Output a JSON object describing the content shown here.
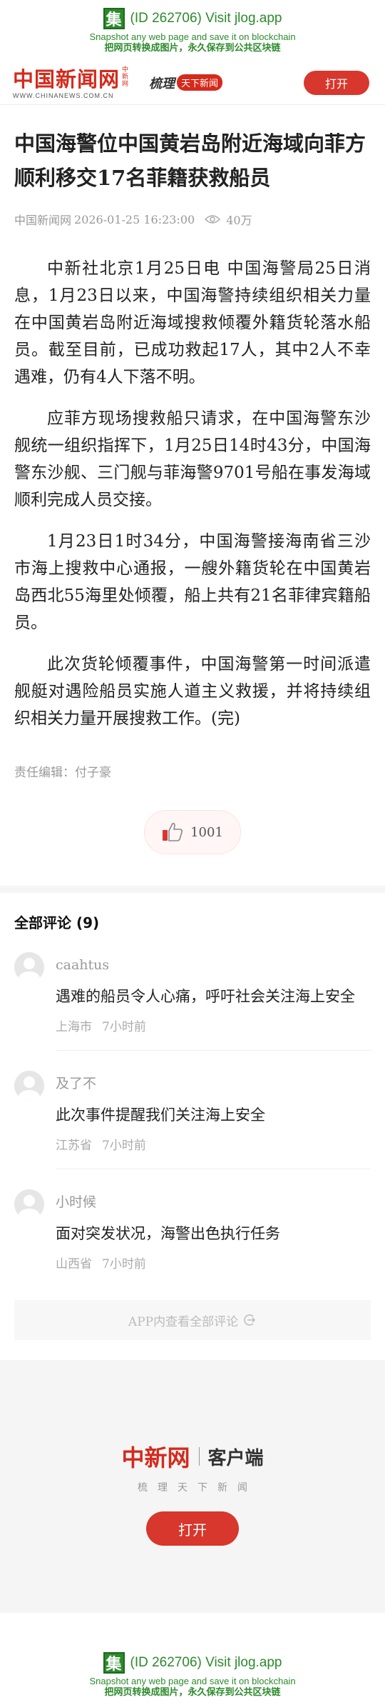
{
  "jlog": {
    "logo": "集",
    "title": "(ID 262706) Visit jlog.app",
    "line1": "Snapshot any web page and save it on blockchain",
    "line2": "把网页转换成图片，永久保存到公共区块链"
  },
  "header": {
    "brand": "中国新闻网",
    "brand_tag": "中新网",
    "url": "WWW.CHINANEWS.COM.CN",
    "slogan_a": "梳理",
    "slogan_b": "天下新闻",
    "open_label": "打开",
    "accent_color": "#d7372c"
  },
  "article": {
    "title": "中国海警位中国黄岩岛附近海域向菲方顺利移交17名菲籍获救船员",
    "source": "中国新闻网",
    "datetime": "2026-01-25 16:23:00",
    "views": "40万",
    "paragraphs": [
      "中新社北京1月25日电 中国海警局25日消息，1月23日以来，中国海警持续组织相关力量在中国黄岩岛附近海域搜救倾覆外籍货轮落水船员。截至目前，已成功救起17人，其中2人不幸遇难，仍有4人下落不明。",
      "应菲方现场搜救船只请求，在中国海警东沙舰统一组织指挥下，1月25日14时43分，中国海警东沙舰、三门舰与菲海警9701号船在事发海域顺利完成人员交接。",
      "1月23日1时34分，中国海警接海南省三沙市海上搜救中心通报，一艘外籍货轮在中国黄岩岛西北55海里处倾覆，船上共有21名菲律宾籍船员。",
      "此次货轮倾覆事件，中国海警第一时间派遣舰艇对遇险船员实施人道主义救援，并将持续组织相关力量开展搜救工作。(完)"
    ],
    "editor": "责任编辑：付子豪",
    "likes": "1001"
  },
  "comments": {
    "heading": "全部评论 (9)",
    "items": [
      {
        "user": "caahtus",
        "text": "遇难的船员令人心痛，呼吁社会关注海上安全",
        "location": "上海市",
        "time": "7小时前"
      },
      {
        "user": "及了不",
        "text": "此次事件提醒我们关注海上安全",
        "location": "江苏省",
        "time": "7小时前"
      },
      {
        "user": "小时候",
        "text": "面对突发状况，海警出色执行任务",
        "location": "山西省",
        "time": "7小时前"
      }
    ],
    "more_label": "APP内查看全部评论"
  },
  "promo": {
    "brand": "中新网",
    "client": "客户端",
    "tagline": "梳理天下新闻",
    "open_label": "打开"
  }
}
